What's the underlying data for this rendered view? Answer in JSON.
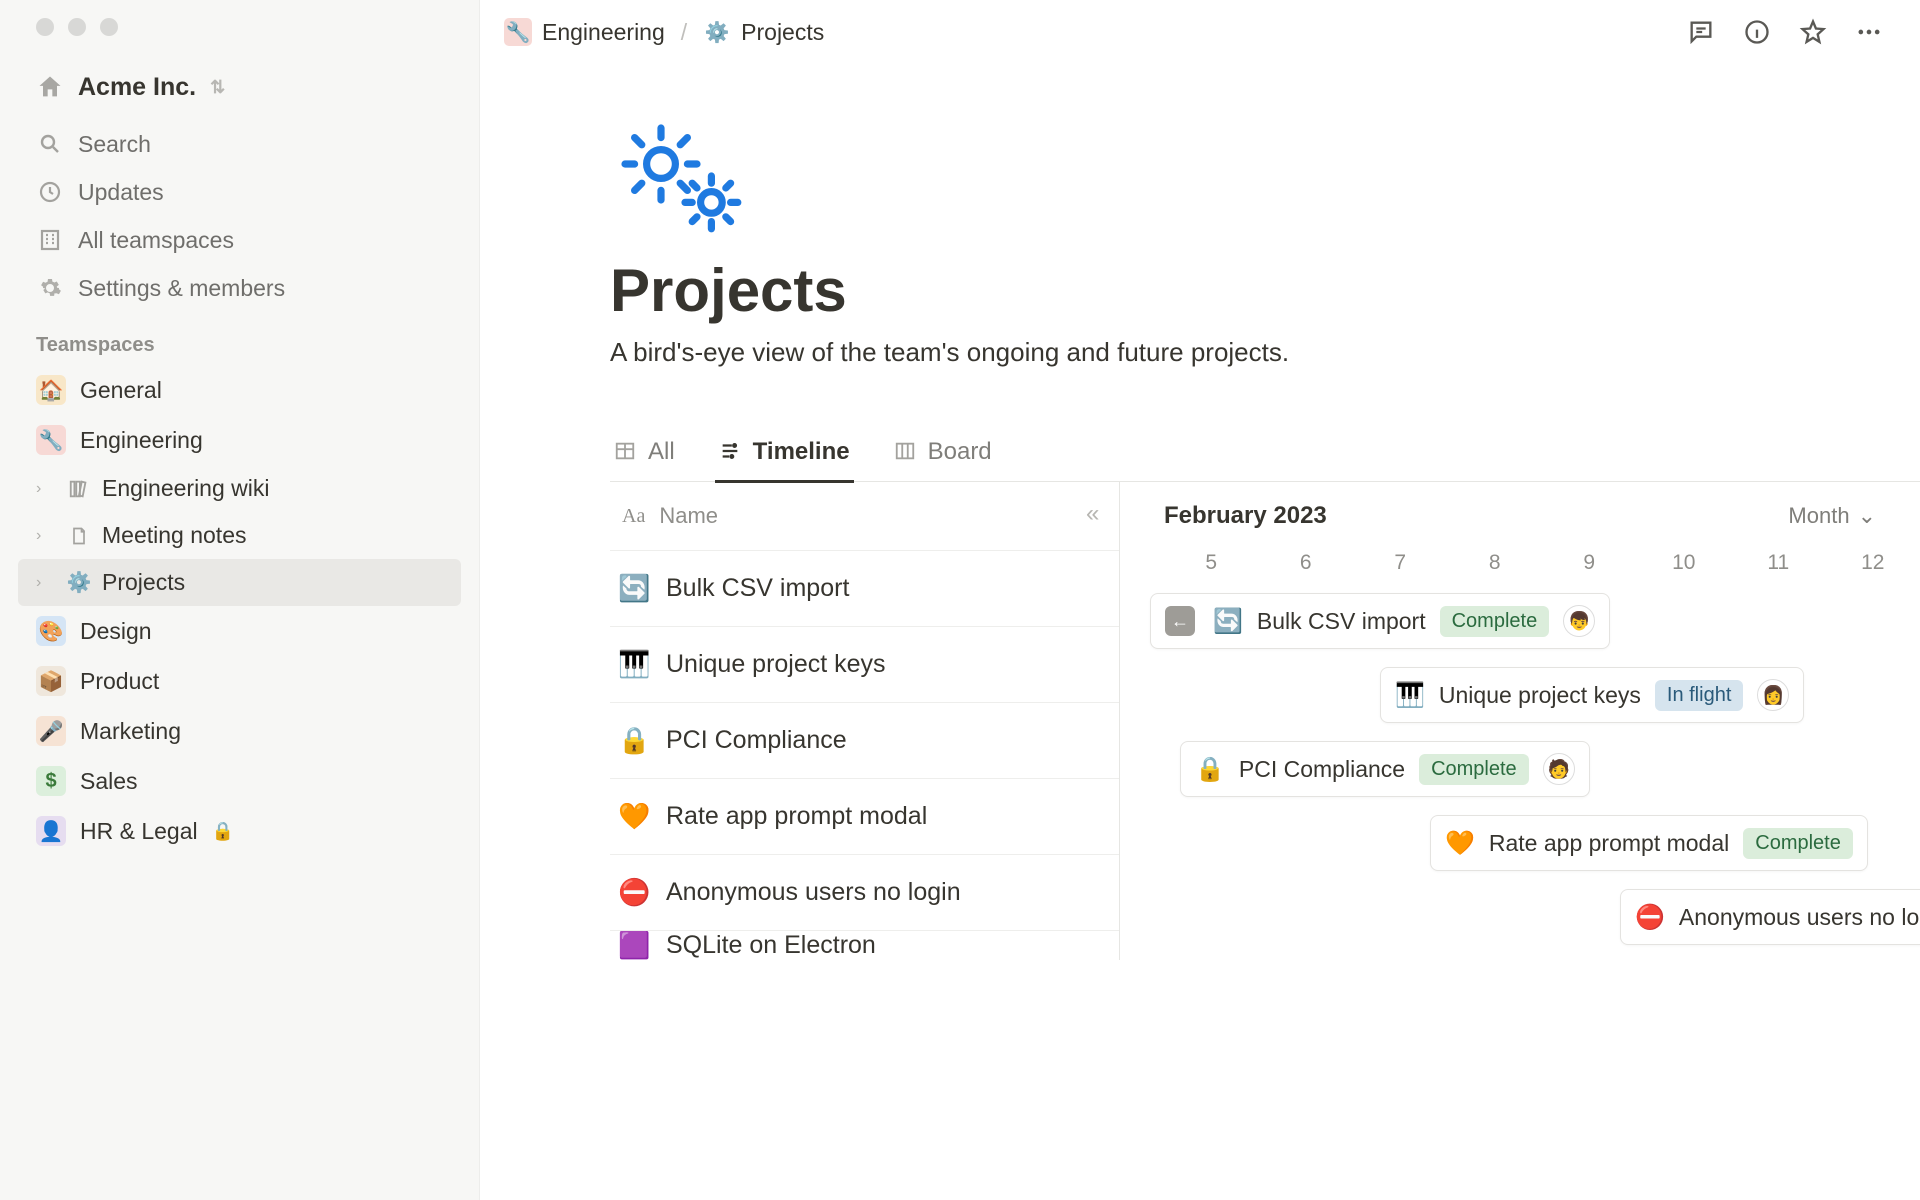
{
  "workspace": {
    "name": "Acme Inc."
  },
  "nav": {
    "search": "Search",
    "updates": "Updates",
    "allTeamspaces": "All teamspaces",
    "settings": "Settings & members"
  },
  "sidebar": {
    "sectionLabel": "Teamspaces",
    "items": [
      {
        "label": "General",
        "emoji": "🏠",
        "bg": "#f8e7c8"
      },
      {
        "label": "Engineering",
        "emoji": "🔧",
        "bg": "#f7d9d5"
      },
      {
        "label": "Design",
        "emoji": "🎨",
        "bg": "#d5e5f5"
      },
      {
        "label": "Product",
        "emoji": "📦",
        "bg": "#efe7dc"
      },
      {
        "label": "Marketing",
        "emoji": "🎤",
        "bg": "#f6e3d4"
      },
      {
        "label": "Sales",
        "emoji": "$",
        "bg": "#dcefdc"
      },
      {
        "label": "HR & Legal",
        "emoji": "👤",
        "bg": "#e6ddf0",
        "locked": true
      }
    ],
    "engineeringChildren": [
      {
        "label": "Engineering wiki",
        "iconName": "books-icon"
      },
      {
        "label": "Meeting notes",
        "iconName": "document-icon"
      },
      {
        "label": "Projects",
        "iconName": "gears-icon",
        "selected": true
      }
    ]
  },
  "breadcrumb": {
    "parent": "Engineering",
    "current": "Projects"
  },
  "page": {
    "title": "Projects",
    "description": "A bird's-eye view of the team's ongoing and future projects."
  },
  "tabs": [
    {
      "label": "All"
    },
    {
      "label": "Timeline",
      "active": true
    },
    {
      "label": "Board"
    }
  ],
  "nameColumn": {
    "header": "Name",
    "typeIcon": "Aa"
  },
  "timeline": {
    "month": "February 2023",
    "rangeLabel": "Month",
    "days": [
      "5",
      "6",
      "7",
      "8",
      "9",
      "10",
      "11",
      "12"
    ]
  },
  "rows": [
    {
      "emoji": "🔄",
      "name": "Bulk CSV import",
      "status": "Complete",
      "statusClass": "complete",
      "barLeft": 30,
      "avatar": "👦"
    },
    {
      "emoji": "🎹",
      "name": "Unique project keys",
      "status": "In flight",
      "statusClass": "inflight",
      "barLeft": 260,
      "avatar": "👩"
    },
    {
      "emoji": "🔒",
      "name": "PCI Compliance",
      "status": "Complete",
      "statusClass": "complete",
      "barLeft": 60,
      "avatar": "🧑"
    },
    {
      "emoji": "🧡",
      "name": "Rate app prompt modal",
      "status": "Complete",
      "statusClass": "complete",
      "barLeft": 310
    },
    {
      "emoji": "⛔",
      "name": "Anonymous users no login",
      "barLeft": 500
    },
    {
      "emoji": "🟪",
      "name": "SQLite on Electron",
      "barLeft": 420
    }
  ]
}
